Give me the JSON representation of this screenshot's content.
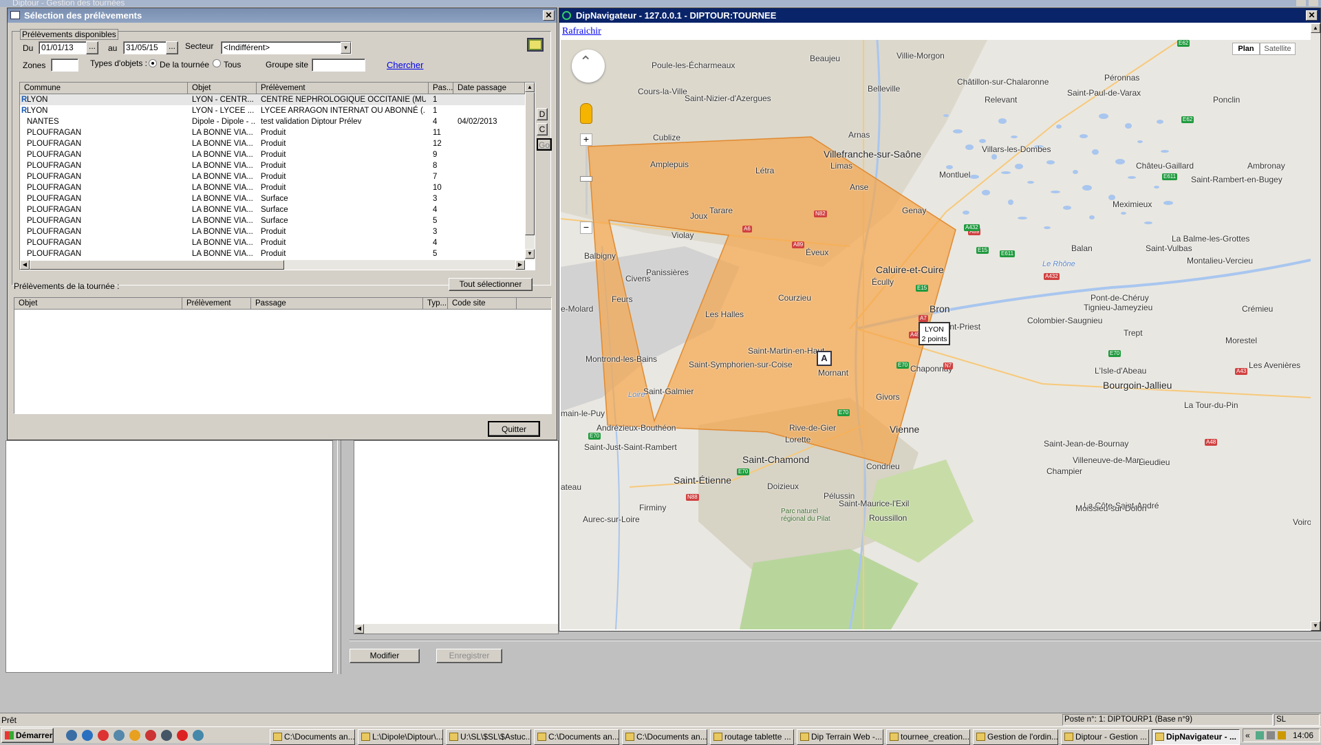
{
  "app": {
    "bg_title": "Diptour - Gestion des tournées"
  },
  "dialog": {
    "title": "Sélection des prélèvements",
    "group_label": "Prélèvements disponibles",
    "du_label": "Du",
    "du_value": "01/01/13",
    "au_label": "au",
    "au_value": "31/05/15",
    "ellipsis": "...",
    "secteur_label": "Secteur",
    "secteur_value": "<Indifférent>",
    "zones_label": "Zones",
    "types_label": "Types d'objets :",
    "radio_tournee": "De la tournée",
    "radio_tous": "Tous",
    "groupe_label": "Groupe site",
    "chercher": "Chercher",
    "side_buttons": [
      "D",
      "C",
      "Go"
    ],
    "columns": [
      "Commune",
      "Objet",
      "Prélèvement",
      "Pas...",
      "Date passage"
    ],
    "rows": [
      {
        "flag": "R",
        "commune": "LYON",
        "objet": "LYON - CENTR...",
        "prelev": "CENTRE NEPHROLOGIQUE OCCITANIE (MU...",
        "pas": "1",
        "date": ""
      },
      {
        "flag": "R",
        "commune": "LYON",
        "objet": "LYON - LYCEE ...",
        "prelev": "LYCEE ARRAGON INTERNAT OU ABONNÉ (...",
        "pas": "1",
        "date": ""
      },
      {
        "flag": "",
        "commune": "NANTES",
        "objet": "Dipole - Dipole - ...",
        "prelev": "test validation Diptour Prélev",
        "pas": "4",
        "date": "04/02/2013"
      },
      {
        "flag": "",
        "commune": "PLOUFRAGAN",
        "objet": "LA BONNE VIA...",
        "prelev": "Produit",
        "pas": "11",
        "date": ""
      },
      {
        "flag": "",
        "commune": "PLOUFRAGAN",
        "objet": "LA BONNE VIA...",
        "prelev": "Produit",
        "pas": "12",
        "date": ""
      },
      {
        "flag": "",
        "commune": "PLOUFRAGAN",
        "objet": "LA BONNE VIA...",
        "prelev": "Produit",
        "pas": "9",
        "date": ""
      },
      {
        "flag": "",
        "commune": "PLOUFRAGAN",
        "objet": "LA BONNE VIA...",
        "prelev": "Produit",
        "pas": "8",
        "date": ""
      },
      {
        "flag": "",
        "commune": "PLOUFRAGAN",
        "objet": "LA BONNE VIA...",
        "prelev": "Produit",
        "pas": "7",
        "date": ""
      },
      {
        "flag": "",
        "commune": "PLOUFRAGAN",
        "objet": "LA BONNE VIA...",
        "prelev": "Produit",
        "pas": "10",
        "date": ""
      },
      {
        "flag": "",
        "commune": "PLOUFRAGAN",
        "objet": "LA BONNE VIA...",
        "prelev": "Surface",
        "pas": "3",
        "date": ""
      },
      {
        "flag": "",
        "commune": "PLOUFRAGAN",
        "objet": "LA BONNE VIA...",
        "prelev": "Surface",
        "pas": "4",
        "date": ""
      },
      {
        "flag": "",
        "commune": "PLOUFRAGAN",
        "objet": "LA BONNE VIA...",
        "prelev": "Surface",
        "pas": "5",
        "date": ""
      },
      {
        "flag": "",
        "commune": "PLOUFRAGAN",
        "objet": "LA BONNE VIA...",
        "prelev": "Produit",
        "pas": "3",
        "date": ""
      },
      {
        "flag": "",
        "commune": "PLOUFRAGAN",
        "objet": "LA BONNE VIA...",
        "prelev": "Produit",
        "pas": "4",
        "date": ""
      },
      {
        "flag": "",
        "commune": "PLOUFRAGAN",
        "objet": "LA BONNE VIA...",
        "prelev": "Produit",
        "pas": "5",
        "date": ""
      }
    ],
    "tournee_label": "Prélèvements de la tournée :",
    "tout_selectionner": "Tout sélectionner",
    "columns2": [
      "Objet",
      "Prélèvement",
      "Passage",
      "Typ...",
      "Code site"
    ],
    "quitter": "Quitter"
  },
  "bottom": {
    "modifier": "Modifier",
    "enregistrer": "Enregistrer"
  },
  "map_window": {
    "title": "DipNavigateur - 127.0.0.1 - DIPTOUR:TOURNEE",
    "refresh": "Rafraichir",
    "map_type_plan": "Plan",
    "map_type_satellite": "Satellite",
    "marker_letter": "A",
    "tooltip_line1": "LYON",
    "tooltip_line2": "2 points",
    "places": [
      "Péronnas",
      "Villie-Morgon",
      "Beaujeu",
      "Poule-les-Écharmeaux",
      "Belleville",
      "Châtillon-sur-Chalaronne",
      "Cours-la-Ville",
      "Saint-Nizier-d'Azergues",
      "Relevant",
      "Saint-Paul-de-Varax",
      "Ponclin",
      "Cublize",
      "Arnas",
      "Villefranche-sur-Saône",
      "Villars-les-Dombes",
      "Amplepuis",
      "Létra",
      "Limas",
      "Châteu-Gaillard",
      "Ambronay",
      "Montluel",
      "Saint-Rambert-en-Bugey",
      "Anse",
      "Tarare",
      "Genay",
      "Meximieux",
      "Joux",
      "Violay",
      "La Balme-les-Grottes",
      "Balbigny",
      "Saint-Vulbas",
      "Balan",
      "Panissières",
      "Éveux",
      "Caluire-et-Cuire",
      "Montalieu-Vercieu",
      "Civens",
      "Écully",
      "Feurs",
      "Courzieu",
      "Bron",
      "Pont-de-Chéruy",
      "Les Halles",
      "Tignieu-Jameyzieu",
      "Crémieu",
      "Colombier-Saugnieu",
      "Saint-Priest",
      "Trept",
      "Morestel",
      "Saint-Martin-en-Haut",
      "Montrond-les-Bains",
      "Saint-Symphorien-sur-Coise",
      "Mornant",
      "Chaponnay",
      "L'Isle-d'Abeau",
      "Les Avenières",
      "Saint-Galmier",
      "Givors",
      "Bourgoin-Jallieu",
      "La Tour-du-Pin",
      "main-le-Puy",
      "Andrézieux-Bouthéon",
      "Rive-de-Gier",
      "Vienne",
      "Lorette",
      "Saint-Just-Saint-Rambert",
      "Saint-Jean-de-Bournay",
      "Saint-Chamond",
      "Villeneuve-de-Marc",
      "Condrieu",
      "Lieudieu",
      "Champier",
      "Saint-Étienne",
      "Doizieux",
      "ateau",
      "Pélussin",
      "Firminy",
      "Saint-Maurice-l'Exil",
      "La Côte-Saint-André",
      "Aurec-sur-Loire",
      "Roussillon",
      "Moissieu-sur-Dolon",
      "e-Molard",
      "Voiro",
      "Parc naturel régional du Pilat",
      "Le Rhône",
      "Loire"
    ],
    "roads": [
      "E62",
      "E62",
      "E611",
      "D11",
      "N82",
      "A6",
      "A89",
      "A89",
      "A432",
      "E15",
      "E611",
      "A432",
      "E15",
      "A7",
      "A450",
      "E70",
      "E70",
      "N7",
      "E70",
      "A48",
      "E70",
      "N88",
      "E70",
      "A43"
    ]
  },
  "status": {
    "left": "Prêt",
    "poste": "Poste n°: 1: DIPTOURP1 (Base n°9)",
    "user": "SL",
    "clock": "14:06"
  },
  "taskbar": {
    "start": "Démarrer",
    "items": [
      "C:\\Documents an...",
      "L:\\Dipole\\Diptour\\...",
      "U:\\SL\\$SL\\$Astuc...",
      "C:\\Documents an...",
      "C:\\Documents an...",
      "routage tablette ...",
      "Dip Terrain Web -...",
      "tournee_creation...",
      "Gestion de l'ordin...",
      "Diptour - Gestion ...",
      "DipNavigateur - ..."
    ],
    "active_index": 10,
    "tray_chevron": "«"
  },
  "colors": {
    "polygon": "#f5a54a",
    "title_active": "#0a246a",
    "title_inactive": "#7a8fb0",
    "link": "#0000ee"
  }
}
